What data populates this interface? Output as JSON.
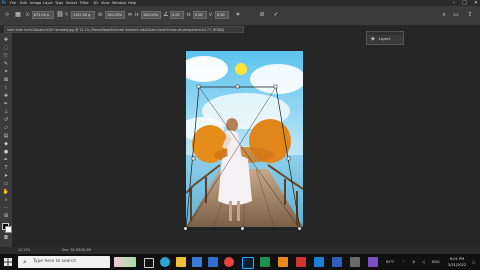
{
  "app": {
    "menus": [
      "File",
      "Edit",
      "Image",
      "Layer",
      "Type",
      "Select",
      "Filter",
      "3D",
      "View",
      "Window",
      "Help"
    ]
  },
  "options_bar": {
    "x_value": "672.00 p",
    "y_value": "1167.00 p",
    "w_value": "100.00%",
    "h_value": "100.00%",
    "angle_value": "0.00",
    "h_skew_value": "0.00",
    "v_skew_value": "0.00"
  },
  "document": {
    "tab_title": "loert slide fun%20today%20f remotely.jpg @ 12.1% (Trees&Road&Surreal Sentient-Ink&Vision-hand-Frame-at-perspective-lvl-77, RGB/8)"
  },
  "layers_panel": {
    "label": "Layers"
  },
  "status_bar": {
    "zoom": "12.13%",
    "doc_info": "Doc: 36.3M/36.3M"
  },
  "taskbar": {
    "search_placeholder": "Type here to search",
    "weather": "63°F",
    "time": "9:01 PM",
    "date": "3/31/2022"
  },
  "colors": {
    "accent": "#2d8cf0",
    "photoshop_blue": "#31a8ff"
  }
}
